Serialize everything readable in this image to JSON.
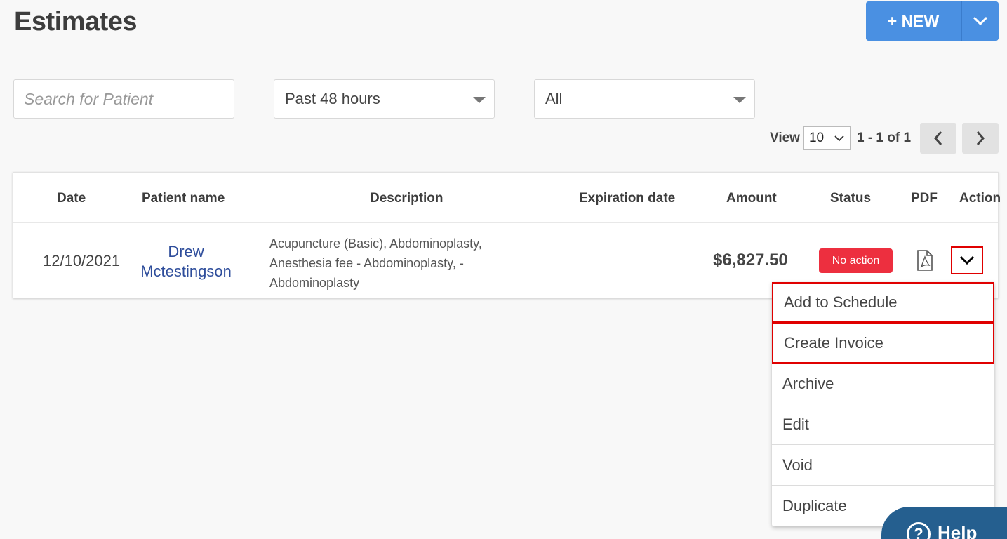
{
  "header": {
    "title": "Estimates",
    "new_label": "+ NEW"
  },
  "filters": {
    "search_placeholder": "Search for Patient",
    "date_range": "Past 48 hours",
    "status": "All"
  },
  "pager": {
    "view_label": "View",
    "page_size": "10",
    "range": "1 - 1 of 1"
  },
  "table": {
    "columns": [
      "Date",
      "Patient name",
      "Description",
      "Expiration date",
      "Amount",
      "Status",
      "PDF",
      "Action"
    ],
    "rows": [
      {
        "date": "12/10/2021",
        "patient_line1": "Drew",
        "patient_line2": "Mctestingson",
        "description_lines": [
          "Acupuncture (Basic), Abdominoplasty,",
          "Anesthesia fee - Abdominoplasty, -",
          "Abdominoplasty"
        ],
        "expiration": "",
        "amount": "$6,827.50",
        "status": "No action"
      }
    ]
  },
  "action_menu": {
    "items": [
      "Add to Schedule",
      "Create Invoice",
      "Archive",
      "Edit",
      "Void",
      "Duplicate"
    ]
  },
  "help": {
    "label": "Help"
  },
  "colors": {
    "primary": "#4a90e2",
    "status_red": "#ed2f3f",
    "link": "#2e4d9b",
    "help_bg": "#255f8f"
  }
}
